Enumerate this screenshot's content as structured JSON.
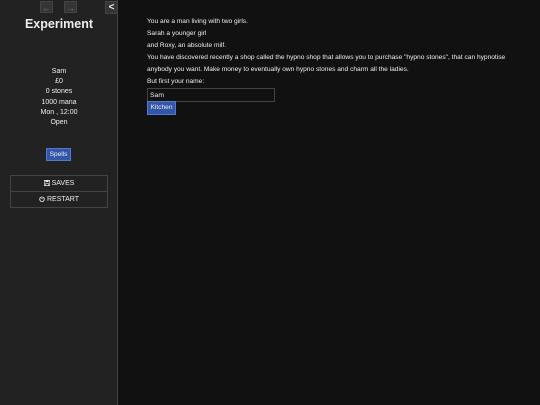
{
  "ui_bar": {
    "history_back_icon": "arrow-left-icon",
    "history_forward_icon": "arrow-right-icon",
    "toggle_icon": "chevron-left-icon",
    "history_back_glyph": "←",
    "history_forward_glyph": "→",
    "toggle_glyph": "<",
    "title": "Experiment",
    "stats": {
      "name": "Sam",
      "money": "£0",
      "stones": "0 stones",
      "mana": "1000 mana",
      "time": "Mon , 12:00",
      "status": "Open"
    },
    "spells_label": "Spells",
    "menu": {
      "saves_label": "SAVES",
      "saves_icon": "save-icon",
      "restart_label": "RESTART",
      "restart_icon": "power-icon"
    }
  },
  "passage": {
    "lines": [
      "You are a man living with two girls.",
      "Sarah a younger girl",
      "and Roxy, an absolute milf.",
      "You have discovered recently a shop called the hypno shop that allows you to purchase \"hypno stones\", that can hypnotise anybody you want. Make money to eventually own hypno stones and charm all the ladies.",
      "But first your name:"
    ],
    "name_value": "Sam",
    "kitchen_link": "Kitchen"
  },
  "colors": {
    "background": "#111111",
    "sidebar": "#222222",
    "border": "#444444",
    "link_button": "#3355aa",
    "text": "#eeeeee"
  }
}
